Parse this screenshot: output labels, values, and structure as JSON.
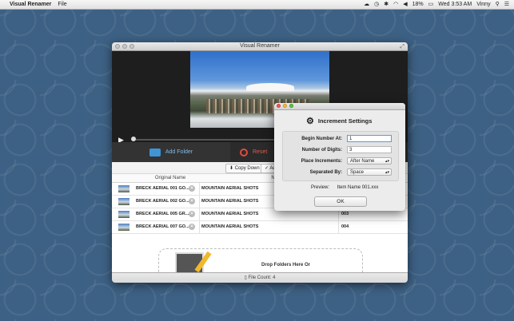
{
  "menubar": {
    "app_name": "Visual Renamer",
    "menus": [
      "File"
    ],
    "battery": "18%",
    "clock": "Wed 3:53 AM",
    "user": "Vinny"
  },
  "window": {
    "title": "Visual Renamer",
    "add_folder_label": "Add Folder",
    "reset_label": "Reset",
    "copy_down_label": "Copy Down",
    "add_label": "Ad",
    "columns": {
      "original": "Original Name",
      "new": "New Na"
    },
    "rows": [
      {
        "original": "BRECK AERIAL 001 GO...",
        "new_name": "MOUNTAIN AERIAL SHOTS",
        "increment": ""
      },
      {
        "original": "BRECK AERIAL 002 GO...",
        "new_name": "MOUNTAIN AERIAL SHOTS",
        "increment": ""
      },
      {
        "original": "BRECK AERIAL 005 GR...",
        "new_name": "MOUNTAIN AERIAL SHOTS",
        "increment": "003"
      },
      {
        "original": "BRECK AERIAL 007 GO...",
        "new_name": "MOUNTAIN AERIAL SHOTS",
        "increment": "004"
      }
    ],
    "drop_text": "Drop Folders Here Or",
    "file_count": "File Count: 4"
  },
  "dialog": {
    "title": "Increment Settings",
    "begin_label": "Begin Number At:",
    "begin_value": "1",
    "digits_label": "Number of Digits:",
    "digits_value": "3",
    "place_label": "Place Increments:",
    "place_value": "After Name",
    "separated_label": "Separated By:",
    "separated_value": "Space",
    "preview_label": "Preview:",
    "preview_value": "Item Name 001.xxx",
    "ok_label": "OK"
  }
}
